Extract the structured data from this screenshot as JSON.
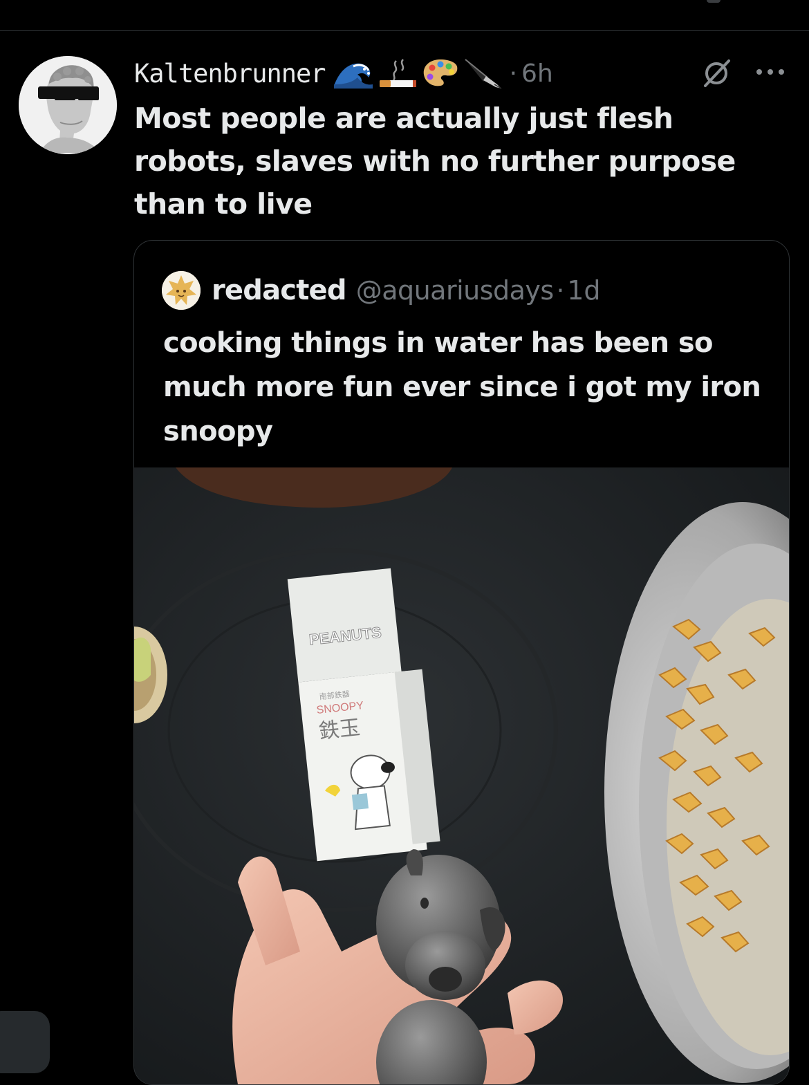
{
  "post": {
    "author_name": "Kaltenbrunner",
    "author_emojis": [
      "wave-emoji",
      "cigarette-emoji",
      "palette-emoji",
      "fountain-pen-emoji"
    ],
    "dot": "·",
    "timestamp": "6h",
    "text": "Most people are actually just flesh robots, slaves with no further purpose than to live"
  },
  "quote": {
    "name": "redacted",
    "handle": "@aquariusdays",
    "dot": "·",
    "timestamp": "1d",
    "text": "cooking things in water has been so much more fun ever since i got my iron snoopy",
    "media": {
      "box_brand": "PEANUTS",
      "box_subtitle": "南部鉄器",
      "box_name": "SNOOPY",
      "box_kanji": "鉄玉"
    }
  },
  "icons": {
    "grok": "grok-icon",
    "more": "more-icon"
  },
  "colors": {
    "background": "#000000",
    "text_primary": "#e7e9ea",
    "text_secondary": "#71767b",
    "border": "#2f3336"
  }
}
